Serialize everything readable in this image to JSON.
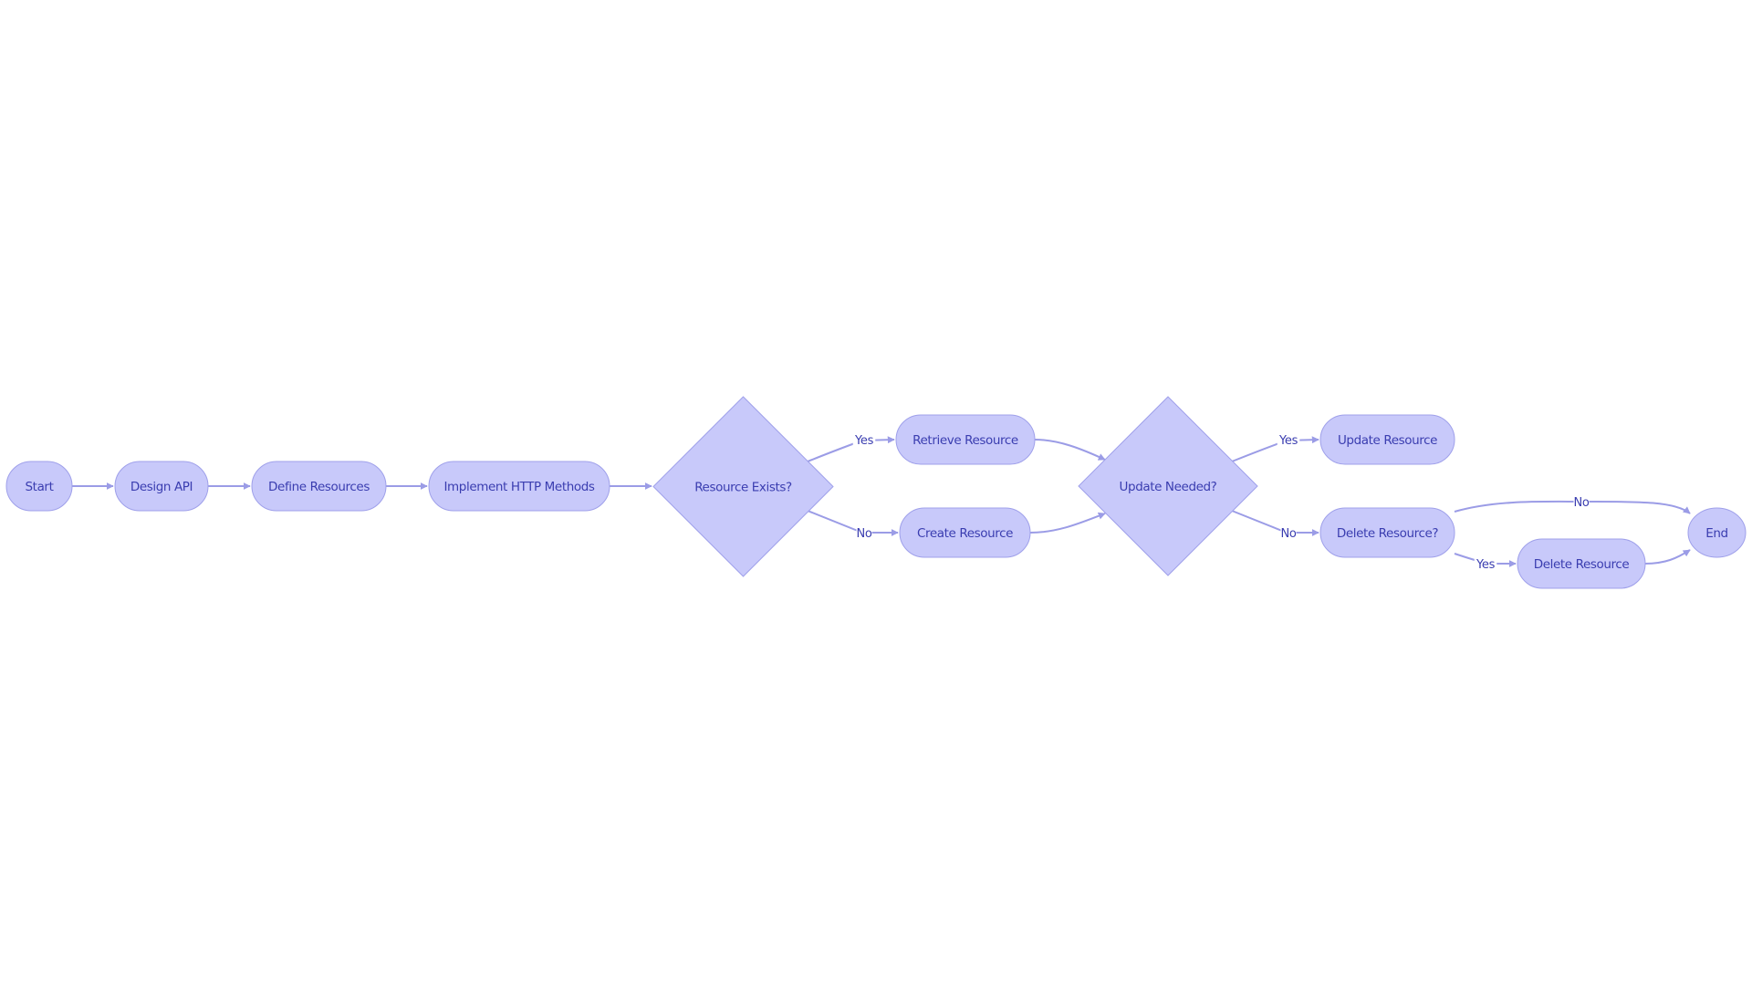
{
  "diagram": {
    "type": "flowchart",
    "direction": "left-to-right",
    "colors": {
      "node_fill": "#c8c9fa",
      "node_stroke": "#9fa0ea",
      "edge": "#9b9ce6",
      "text": "#3a3db0",
      "background": "#ffffff"
    },
    "nodes": [
      {
        "id": "start",
        "label": "Start",
        "shape": "stadium"
      },
      {
        "id": "design_api",
        "label": "Design API",
        "shape": "stadium"
      },
      {
        "id": "define_resources",
        "label": "Define Resources",
        "shape": "stadium"
      },
      {
        "id": "implement_http",
        "label": "Implement HTTP Methods",
        "shape": "stadium"
      },
      {
        "id": "resource_exists",
        "label": "Resource Exists?",
        "shape": "diamond"
      },
      {
        "id": "retrieve_resource",
        "label": "Retrieve Resource",
        "shape": "stadium"
      },
      {
        "id": "create_resource",
        "label": "Create Resource",
        "shape": "stadium"
      },
      {
        "id": "update_needed",
        "label": "Update Needed?",
        "shape": "diamond"
      },
      {
        "id": "update_resource",
        "label": "Update Resource",
        "shape": "stadium"
      },
      {
        "id": "delete_resource_q",
        "label": "Delete Resource?",
        "shape": "stadium"
      },
      {
        "id": "delete_resource",
        "label": "Delete Resource",
        "shape": "stadium"
      },
      {
        "id": "end",
        "label": "End",
        "shape": "circle"
      }
    ],
    "edges": [
      {
        "from": "start",
        "to": "design_api",
        "label": ""
      },
      {
        "from": "design_api",
        "to": "define_resources",
        "label": ""
      },
      {
        "from": "define_resources",
        "to": "implement_http",
        "label": ""
      },
      {
        "from": "implement_http",
        "to": "resource_exists",
        "label": ""
      },
      {
        "from": "resource_exists",
        "to": "retrieve_resource",
        "label": "Yes"
      },
      {
        "from": "resource_exists",
        "to": "create_resource",
        "label": "No"
      },
      {
        "from": "retrieve_resource",
        "to": "update_needed",
        "label": ""
      },
      {
        "from": "create_resource",
        "to": "update_needed",
        "label": ""
      },
      {
        "from": "update_needed",
        "to": "update_resource",
        "label": "Yes"
      },
      {
        "from": "update_needed",
        "to": "delete_resource_q",
        "label": "No"
      },
      {
        "from": "delete_resource_q",
        "to": "end",
        "label": "No"
      },
      {
        "from": "delete_resource_q",
        "to": "delete_resource",
        "label": "Yes"
      },
      {
        "from": "delete_resource",
        "to": "end",
        "label": ""
      }
    ]
  }
}
